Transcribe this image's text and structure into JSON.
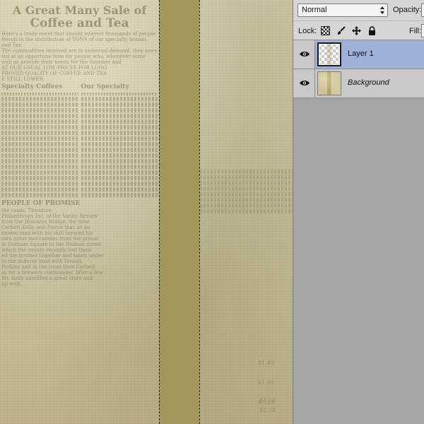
{
  "canvas": {
    "newsprint": {
      "headline_line1": "A Great Many Sale of",
      "headline_line2": "Coffee and Tea",
      "intro_lines": [
        "Here's a trade event that should interest thousands of people",
        "Result in the distribution of TONS of our specialty brands",
        "and Tea.",
        "The commodities involved are in universal demand, they were",
        "ted at an opportune time for people who, whenever some",
        "well as provide their needs for the Summer and",
        "AT OUR USUAL LOW PRICES FOR LONG",
        "PROVED QUALITY OF COFFEE AND TEA",
        "E STILL LOWER."
      ],
      "left_column_heading": "Specialty Coffees",
      "right_column_heading": "Our Specialty",
      "story_heading": "PEOPLE OF PROMISE",
      "story_lines": [
        "the cases, Theodore",
        "Philanthropy Inc. of the Vanity Review",
        "from the Brooklyn Bridge, the time",
        "Corbett Kelly and Pierce that an an",
        "known man with his skill favored his",
        "own great mercantiles from the prison",
        "in Durham Square to the Hudson street",
        "which the county recently lost them",
        "ed the brother together and taken under",
        "to the sufferer kind with Dowell.",
        "Perkins and in the room then Corbett",
        "as for a brewery confounder. After a few",
        "Mr. Kelly admitted a great store and",
        "up with,"
      ],
      "prices": [
        "$1.40",
        "$1.60",
        "$2.24",
        "$3.24",
        "$2.34"
      ]
    },
    "selection_marquee": "Rectangular selection"
  },
  "layers_panel": {
    "blend_mode": "Normal",
    "opacity_label": "Opacity:",
    "opacity_value": "",
    "lock_label": "Lock:",
    "fill_label": "Fill:",
    "fill_value": "",
    "layers": [
      {
        "name": "Layer 1",
        "visible": true,
        "selected": true,
        "italic": false
      },
      {
        "name": "Background",
        "visible": true,
        "selected": false,
        "italic": true
      }
    ],
    "colors": {
      "selected_row": "#9fb1da",
      "stripe": "#a2965b",
      "panel_bg": "#a5a5a5"
    }
  }
}
